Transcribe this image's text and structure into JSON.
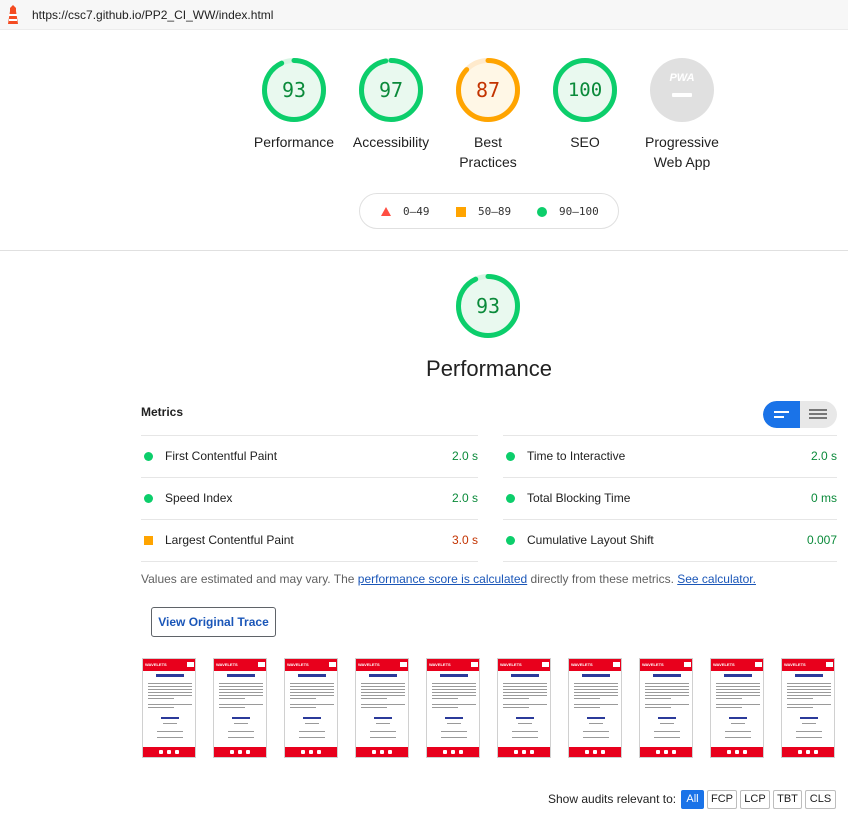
{
  "topbar": {
    "url": "https://csc7.github.io/PP2_CI_WW/index.html",
    "icon": "lighthouse-icon"
  },
  "categories": [
    {
      "id": "performance",
      "score": "93",
      "label": "Performance",
      "status": "pass",
      "fraction": 0.93
    },
    {
      "id": "accessibility",
      "score": "97",
      "label": "Accessibility",
      "status": "pass",
      "fraction": 0.97
    },
    {
      "id": "best-practices",
      "score": "87",
      "label_line1": "Best",
      "label_line2": "Practices",
      "status": "average",
      "fraction": 0.87
    },
    {
      "id": "seo",
      "score": "100",
      "label": "SEO",
      "status": "pass",
      "fraction": 1.0
    },
    {
      "id": "pwa",
      "badge": "PWA",
      "label_line1": "Progressive",
      "label_line2": "Web App",
      "status": "na"
    }
  ],
  "legend": {
    "fail": "0–49",
    "average": "50–89",
    "pass": "90–100"
  },
  "performance": {
    "score": "93",
    "title": "Performance",
    "fraction": 0.93
  },
  "metrics": {
    "heading": "Metrics",
    "left": [
      {
        "name": "First Contentful Paint",
        "value": "2.0 s",
        "status": "pass"
      },
      {
        "name": "Speed Index",
        "value": "2.0 s",
        "status": "pass"
      },
      {
        "name": "Largest Contentful Paint",
        "value": "3.0 s",
        "status": "average"
      }
    ],
    "right": [
      {
        "name": "Time to Interactive",
        "value": "2.0 s",
        "status": "pass"
      },
      {
        "name": "Total Blocking Time",
        "value": "0 ms",
        "status": "pass"
      },
      {
        "name": "Cumulative Layout Shift",
        "value": "0.007",
        "status": "pass"
      }
    ]
  },
  "note": {
    "part1": "Values are estimated and may vary. The ",
    "link1": "performance score is calculated",
    "part2": " directly from these metrics. ",
    "link2": "See calculator."
  },
  "trace_button": "View Original Trace",
  "filmstrip": {
    "count": 10,
    "header_text": "WAVELETS"
  },
  "audits": {
    "label": "Show audits relevant to:",
    "chips": [
      "All",
      "FCP",
      "LCP",
      "TBT",
      "CLS"
    ],
    "active": "All"
  },
  "colors": {
    "pass": "#0cce6b",
    "average": "#ffa400",
    "fail": "#ff4e42",
    "na": "#e0e0e0"
  }
}
